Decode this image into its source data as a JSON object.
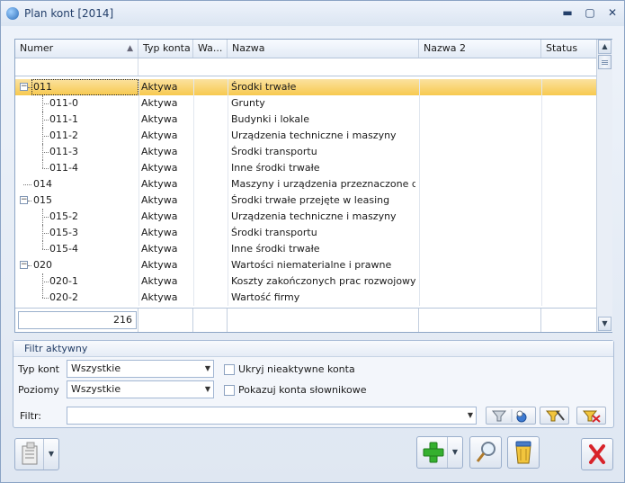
{
  "window": {
    "title": "Plan kont [2014]",
    "minimize_glyph": "▬",
    "maximize_glyph": "▢",
    "close_glyph": "✕"
  },
  "grid": {
    "columns": [
      "Numer",
      "Typ konta",
      "Wa...",
      "Nazwa",
      "Nazwa 2",
      "Status"
    ],
    "sort_glyph": "▲",
    "rows": [
      {
        "numer": "011",
        "typ": "Aktywa",
        "nazwa": "Środki trwałe"
      },
      {
        "numer": "011-0",
        "typ": "Aktywa",
        "nazwa": "Grunty"
      },
      {
        "numer": "011-1",
        "typ": "Aktywa",
        "nazwa": "Budynki i lokale"
      },
      {
        "numer": "011-2",
        "typ": "Aktywa",
        "nazwa": "Urządzenia techniczne i maszyny"
      },
      {
        "numer": "011-3",
        "typ": "Aktywa",
        "nazwa": "Środki transportu"
      },
      {
        "numer": "011-4",
        "typ": "Aktywa",
        "nazwa": "Inne środki trwałe"
      },
      {
        "numer": "014",
        "typ": "Aktywa",
        "nazwa": "Maszyny i urządzenia przeznaczone do ..."
      },
      {
        "numer": "015",
        "typ": "Aktywa",
        "nazwa": "Środki trwałe przejęte w leasing"
      },
      {
        "numer": "015-2",
        "typ": "Aktywa",
        "nazwa": "Urządzenia techniczne i maszyny"
      },
      {
        "numer": "015-3",
        "typ": "Aktywa",
        "nazwa": "Środki transportu"
      },
      {
        "numer": "015-4",
        "typ": "Aktywa",
        "nazwa": "Inne środki trwałe"
      },
      {
        "numer": "020",
        "typ": "Aktywa",
        "nazwa": "Wartości niematerialne i prawne"
      },
      {
        "numer": "020-1",
        "typ": "Aktywa",
        "nazwa": "Koszty zakończonych prac rozwojowych"
      },
      {
        "numer": "020-2",
        "typ": "Aktywa",
        "nazwa": "Wartość firmy"
      }
    ],
    "count": "216",
    "collapse_glyph": "−"
  },
  "filter_panel": {
    "title": "Filtr aktywny",
    "typ_kont_label": "Typ kont",
    "typ_kont_value": "Wszystkie",
    "poziomy_label": "Poziomy",
    "poziomy_value": "Wszystkie",
    "hide_inactive_label": "Ukryj nieaktywne konta",
    "show_dictionary_label": "Pokazuj konta słownikowe",
    "filter_label": "Filtr:",
    "filter_value": "",
    "dropdown_glyph": "▼"
  },
  "colors": {
    "selected_row": "#f7c94f",
    "accent": "#24406b",
    "add_green": "#35b02f",
    "close_red": "#d8232a"
  }
}
